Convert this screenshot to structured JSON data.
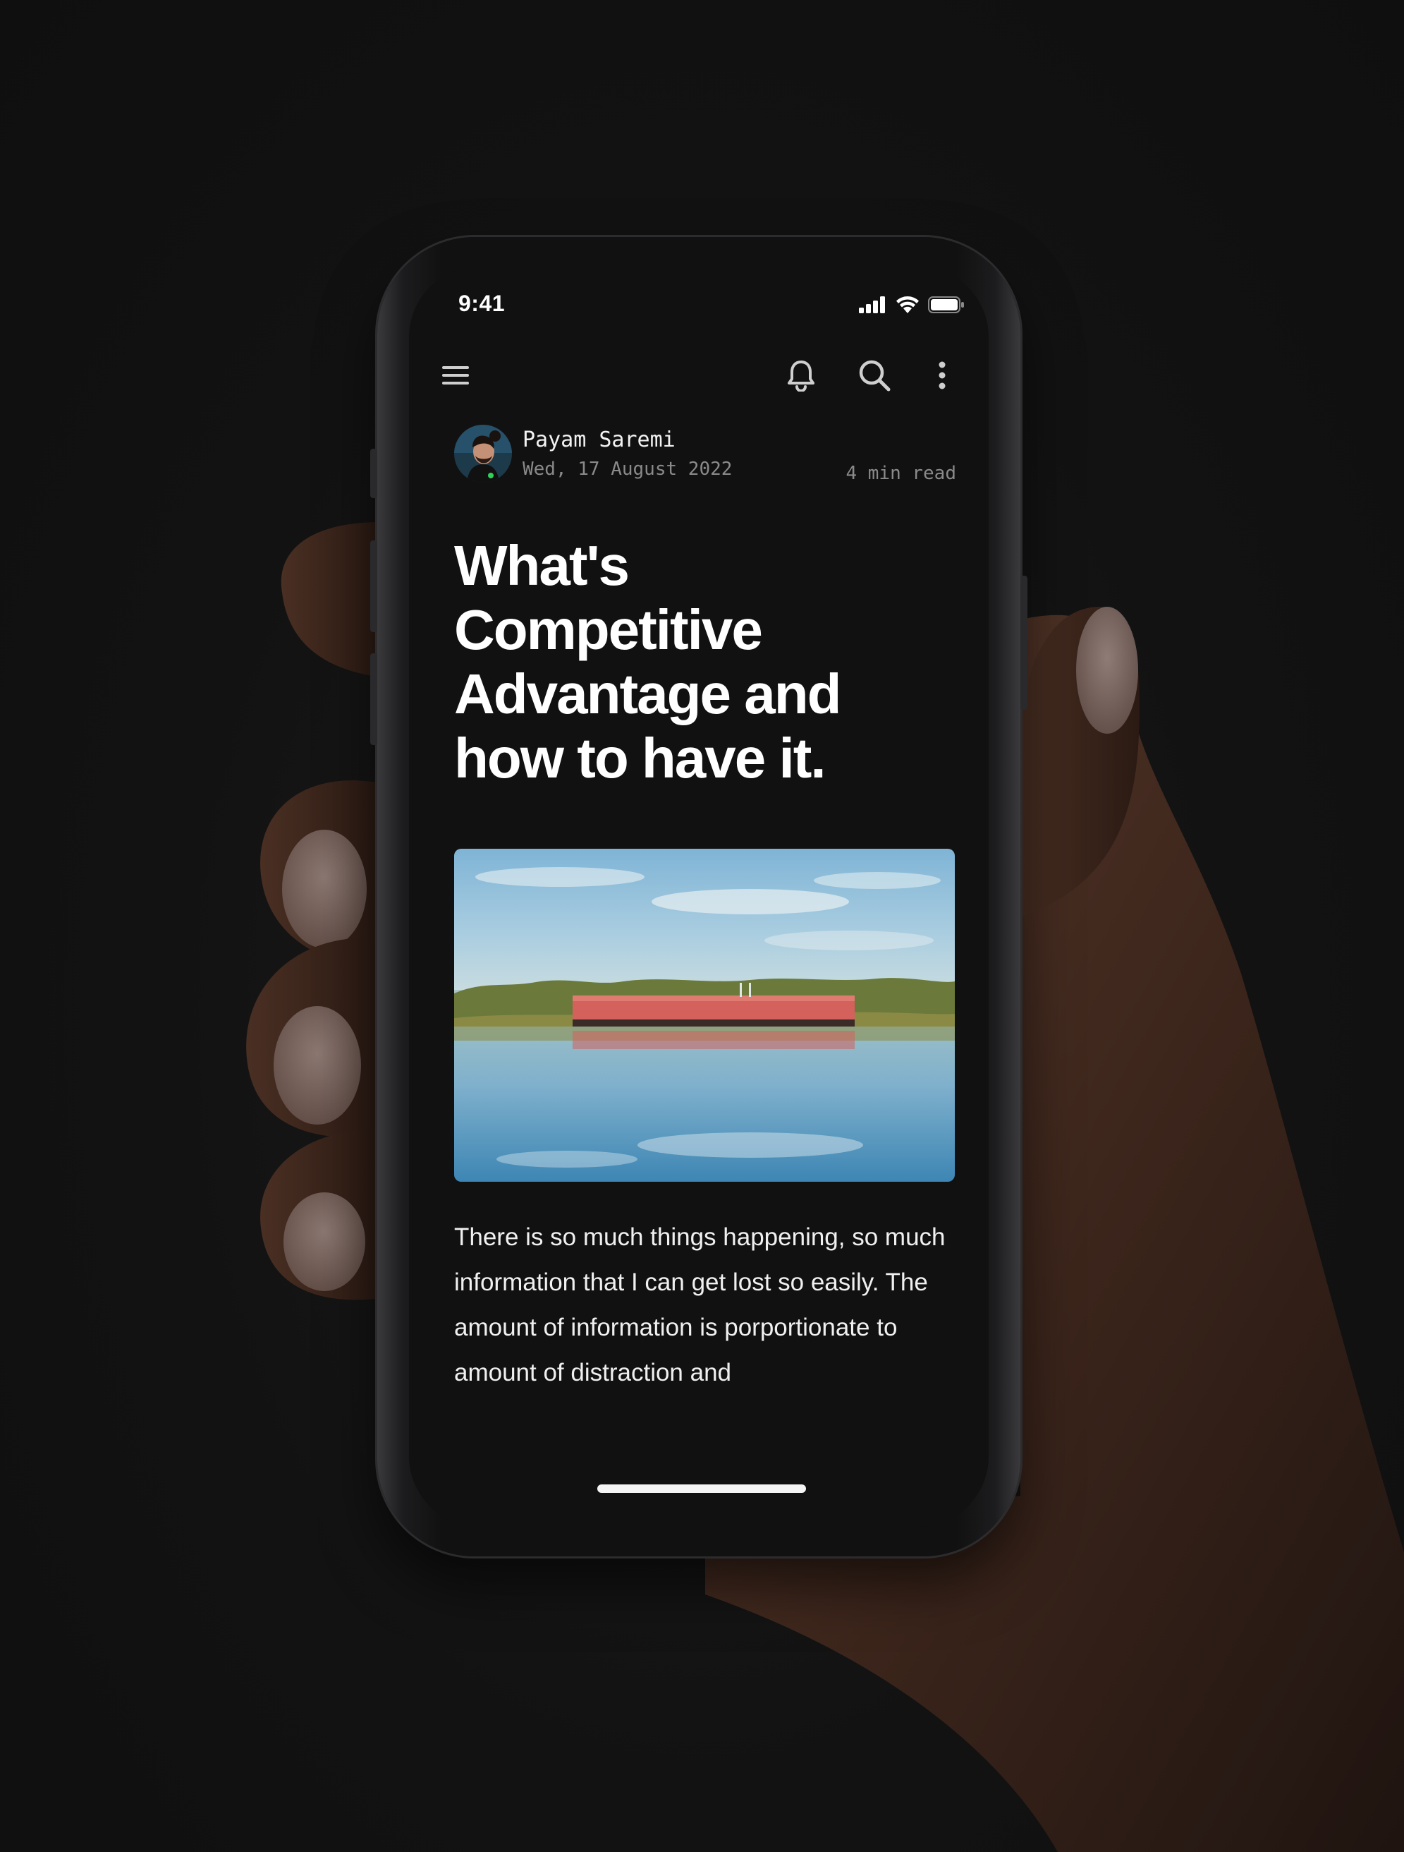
{
  "status_bar": {
    "time": "9:41"
  },
  "toolbar": {
    "icons": [
      "menu-icon",
      "bell-icon",
      "search-icon",
      "more-icon"
    ]
  },
  "article": {
    "author_name": "Payam Saremi",
    "date": "Wed, 17 August 2022",
    "read_time": "4 min read",
    "title": "What's Competitive Advantage and how to have it.",
    "hero_image": "lake-with-red-building-reflection",
    "body": "There is so much things happening, so much information that I can get lost so easily. The amount of information is porportionate to amount of distraction and"
  },
  "colors": {
    "background": "#121212",
    "screen": "#111111",
    "text_primary": "#ffffff",
    "text_secondary": "#8a8a8a"
  }
}
